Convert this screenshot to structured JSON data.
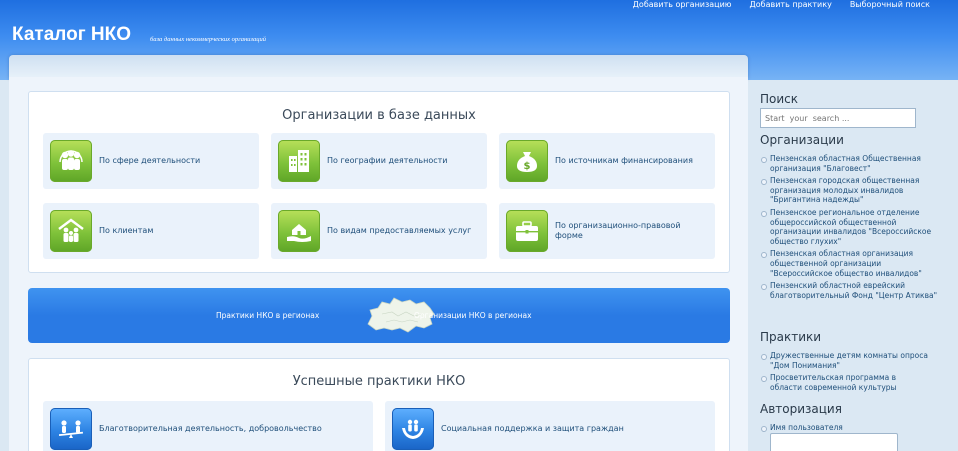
{
  "header": {
    "title": "Каталог НКО",
    "tagline": "база данных некоммерческих организаций",
    "links": [
      "Добавить организацию",
      "Добавить практику",
      "Выборочный поиск"
    ]
  },
  "orgs_box": {
    "title": "Организации в базе данных",
    "cards": [
      {
        "label": "По сфере деятельности",
        "icon": "people-icon"
      },
      {
        "label": "По географии деятельности",
        "icon": "buildings-icon"
      },
      {
        "label": "По источникам финансирования",
        "icon": "money-bag-icon"
      },
      {
        "label": "По клиентам",
        "icon": "family-house-icon"
      },
      {
        "label": "По видам предоставляемых услуг",
        "icon": "house-hand-icon"
      },
      {
        "label": "По организационно-правовой форме",
        "icon": "briefcase-icon"
      }
    ]
  },
  "banner": {
    "left_link": "Практики НКО в регионах",
    "right_link": "Организации НКО в регионах",
    "map_icon": "russia-map-icon"
  },
  "practices_box": {
    "title": "Успешные практики НКО",
    "cards": [
      {
        "label": "Благотворительная деятельность, добровольчество",
        "icon": "seesaw-icon"
      },
      {
        "label": "Социальная поддержка и защита граждан",
        "icon": "hands-people-icon"
      }
    ]
  },
  "sidebar": {
    "search": {
      "title": "Поиск",
      "placeholder": "Start  your  search ..."
    },
    "organizations": {
      "title": "Организации",
      "items": [
        "Пензенская областная Общественная организация \"Благовест\"",
        "Пензенская городская общественная организация молодых инвалидов \"Бригантина надежды\"",
        "Пензенское региональное отделение общероссийской общественной организации инвалидов \"Всероссийское общество глухих\"",
        "Пензенская областная организация общественной организации \"Всероссийское общество инвалидов\"",
        "Пензенский областной еврейский благотворительный Фонд \"Центр Атиква\""
      ]
    },
    "practices": {
      "title": "Практики",
      "items": [
        "Дружественные детям комнаты опроса \"Дом Понимания\"",
        "Просветительская программа в области современной культуры"
      ]
    },
    "auth": {
      "title": "Авторизация",
      "username_label": "Имя пользователя"
    }
  },
  "colors": {
    "header_blue": "#2b7fe8",
    "banner_blue": "#2a7ae4",
    "icon_green": "#7fc23a",
    "icon_blue": "#2d83e3"
  }
}
